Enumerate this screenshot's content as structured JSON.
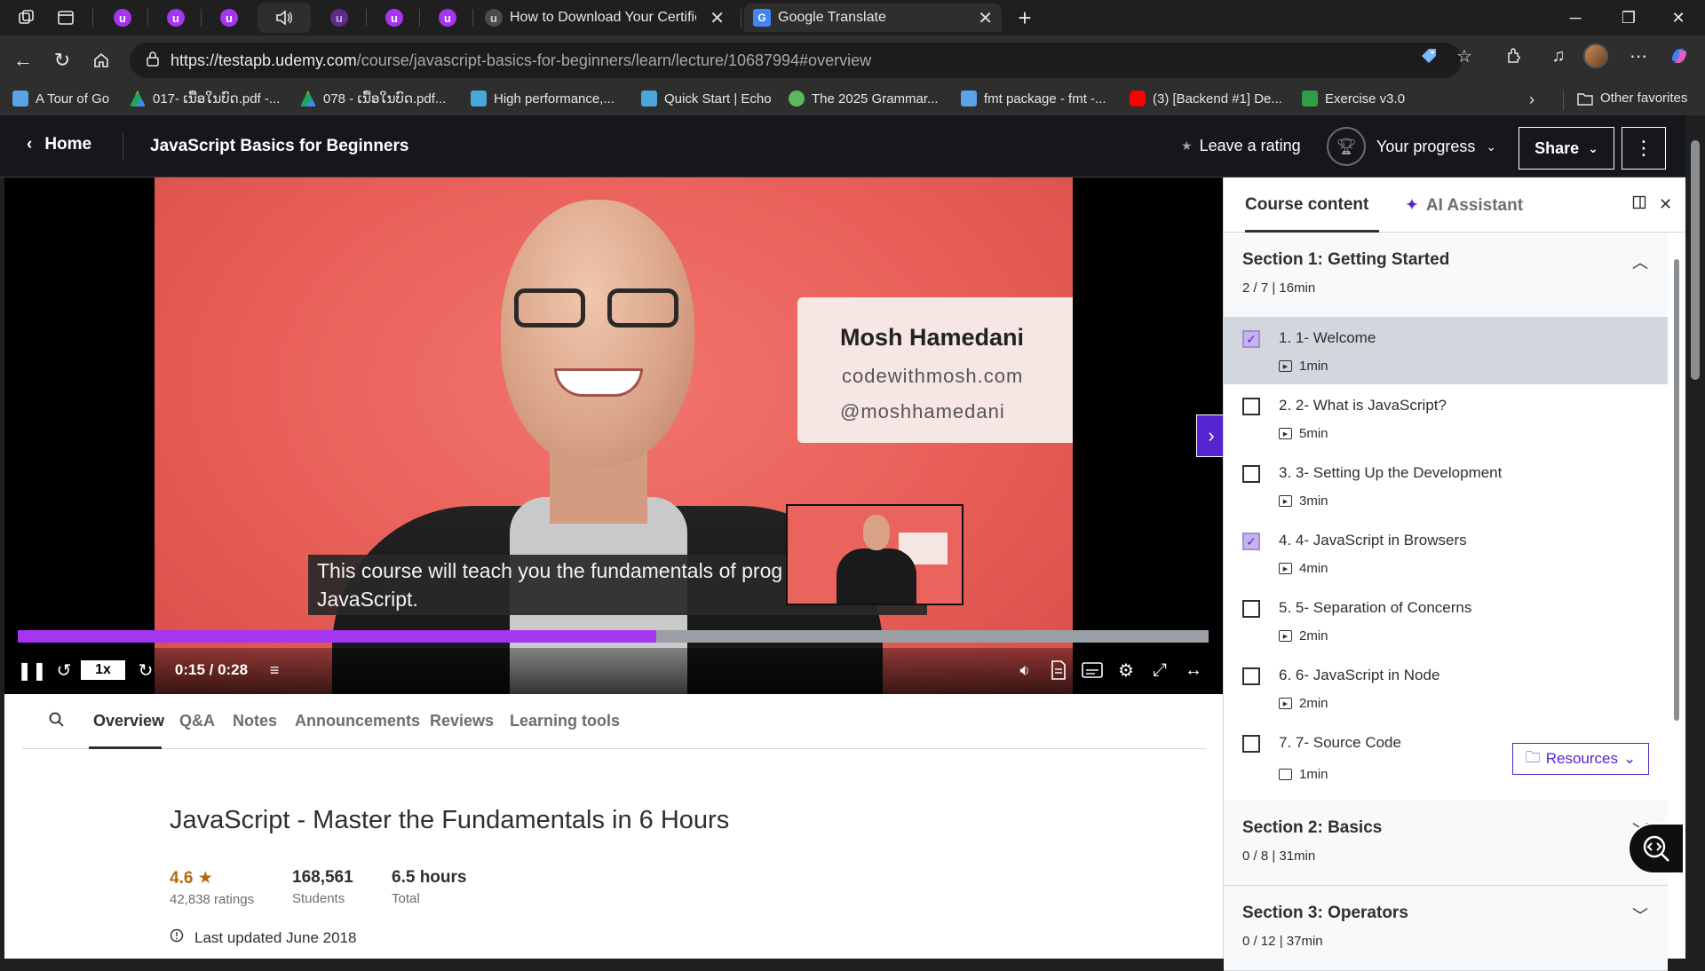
{
  "browser": {
    "tabs": [
      {
        "title": "How to Download Your Certificate",
        "active": false
      },
      {
        "title": "Google Translate",
        "active": true
      }
    ],
    "url_host": "https://testapb.udemy.com",
    "url_path": "/course/javascript-basics-for-beginners/learn/lecture/10687994#overview",
    "bookmarks": [
      "A Tour of Go",
      "017- ເນື້ອໃນບົດ.pdf -...",
      "078 - ເນື້ອໃນບົດ.pdf...",
      "High performance,...",
      "Quick Start | Echo",
      "The 2025 Grammar...",
      "fmt package - fmt -...",
      "(3) [Backend #1] De...",
      "Exercise v3.0"
    ],
    "other_favorites": "Other favorites"
  },
  "header": {
    "home": "Home",
    "course_title": "JavaScript Basics for Beginners",
    "leave_rating": "Leave a rating",
    "your_progress": "Your progress",
    "share": "Share"
  },
  "video": {
    "card_name": "Mosh Hamedani",
    "card_web": "codewithmosh.com",
    "card_handle": "@moshhamedani",
    "caption_line1": "This course will teach you the fundamentals of prog",
    "caption_line2": "JavaScript.",
    "speed": "1x",
    "time": "0:15 / 0:28",
    "progress_fraction": 0.536
  },
  "lower": {
    "tabs": [
      "Overview",
      "Q&A",
      "Notes",
      "Announcements",
      "Reviews",
      "Learning tools"
    ],
    "course_heading": "JavaScript - Master the Fundamentals in 6 Hours",
    "rating_value": "4.6",
    "rating_count": "42,838 ratings",
    "students_value": "168,561",
    "students_label": "Students",
    "hours_value": "6.5 hours",
    "hours_label": "Total",
    "last_updated": "Last updated June 2018"
  },
  "sidebar": {
    "tab_content": "Course content",
    "tab_ai": "AI Assistant",
    "sections": [
      {
        "title": "Section 1: Getting Started",
        "meta": "2 / 7 | 16min"
      },
      {
        "title": "Section 2: Basics",
        "meta": "0 / 8 | 31min"
      },
      {
        "title": "Section 3: Operators",
        "meta": "0 / 12 | 37min"
      }
    ],
    "lectures": [
      {
        "title": "1. 1- Welcome",
        "duration": "1min",
        "checked": true
      },
      {
        "title": "2. 2- What is JavaScript?",
        "duration": "5min",
        "checked": false
      },
      {
        "title": "3. 3- Setting Up the Development",
        "duration": "3min",
        "checked": false
      },
      {
        "title": "4. 4- JavaScript in Browsers",
        "duration": "4min",
        "checked": true
      },
      {
        "title": "5. 5- Separation of Concerns",
        "duration": "2min",
        "checked": false
      },
      {
        "title": "6. 6- JavaScript in Node",
        "duration": "2min",
        "checked": false
      },
      {
        "title": "7. 7- Source Code",
        "duration": "1min",
        "checked": false
      }
    ],
    "resources": "Resources"
  },
  "colors": {
    "udemy_purple": "#a435f0",
    "udemy_indigo": "#5624d0",
    "header_bg": "#16161d"
  }
}
